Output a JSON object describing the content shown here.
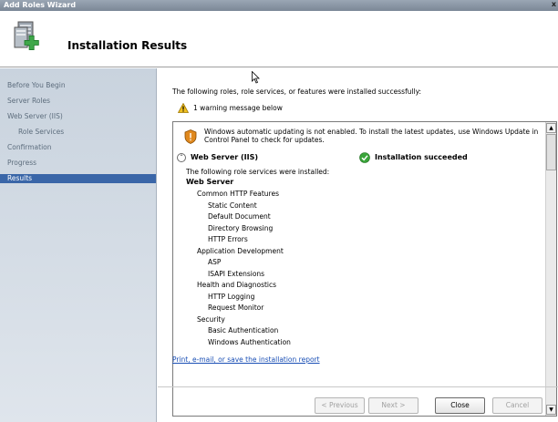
{
  "window": {
    "title": "Add Roles Wizard",
    "close_glyph": "x"
  },
  "header": {
    "title": "Installation Results",
    "icon": "server-roles-add-icon"
  },
  "sidebar": {
    "items": [
      {
        "label": "Before You Begin"
      },
      {
        "label": "Server Roles"
      },
      {
        "label": "Web Server (IIS)"
      },
      {
        "label": "Role Services"
      },
      {
        "label": "Confirmation"
      },
      {
        "label": "Progress"
      },
      {
        "label": "Results"
      }
    ],
    "active": "Results"
  },
  "main": {
    "intro": "The following roles, role services, or features were installed successfully:",
    "warning_summary": "1 warning message below",
    "update_notice": "Windows automatic updating is not enabled. To install the latest updates, use Windows Update in Control Panel to check for updates.",
    "role_title": "Web Server (IIS)",
    "status": "Installation succeeded",
    "installed_intro": "The following role services were installed:",
    "tree": [
      {
        "text": "Web Server",
        "bold": true,
        "level": 0
      },
      {
        "text": "Common HTTP Features",
        "level": 1
      },
      {
        "text": "Static Content",
        "level": 2
      },
      {
        "text": "Default Document",
        "level": 2
      },
      {
        "text": "Directory Browsing",
        "level": 2
      },
      {
        "text": "HTTP Errors",
        "level": 2
      },
      {
        "text": "Application Development",
        "level": 1
      },
      {
        "text": "ASP",
        "level": 2
      },
      {
        "text": "ISAPI Extensions",
        "level": 2
      },
      {
        "text": "Health and Diagnostics",
        "level": 1
      },
      {
        "text": "HTTP Logging",
        "level": 2
      },
      {
        "text": "Request Monitor",
        "level": 2
      },
      {
        "text": "Security",
        "level": 1
      },
      {
        "text": "Basic Authentication",
        "level": 2
      },
      {
        "text": "Windows Authentication",
        "level": 2
      }
    ],
    "report_link": "Print, e-mail, or save the installation report"
  },
  "buttons": {
    "previous": "< Previous",
    "next": "Next >",
    "close": "Close",
    "cancel": "Cancel"
  },
  "colors": {
    "active_nav": "#3a66a8",
    "link": "#1a4fb5",
    "success": "#3aa53a",
    "warning": "#f0c020"
  }
}
